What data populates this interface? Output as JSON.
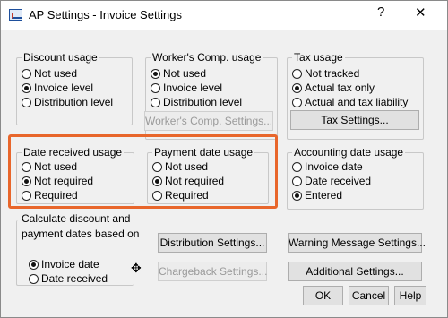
{
  "window": {
    "title": "AP Settings - Invoice Settings",
    "help_glyph": "?",
    "close_glyph": "✕"
  },
  "discount": {
    "legend": "Discount usage",
    "options": [
      "Not used",
      "Invoice level",
      "Distribution level"
    ],
    "selected": 1
  },
  "workers_comp": {
    "legend": "Worker's Comp. usage",
    "options": [
      "Not used",
      "Invoice level",
      "Distribution level"
    ],
    "selected": 0,
    "button": "Worker's Comp. Settings..."
  },
  "tax": {
    "legend": "Tax usage",
    "options": [
      "Not tracked",
      "Actual tax only",
      "Actual and tax liability"
    ],
    "selected": 1,
    "button": "Tax Settings..."
  },
  "date_received": {
    "legend": "Date received usage",
    "options": [
      "Not used",
      "Not required",
      "Required"
    ],
    "selected": 1
  },
  "payment_date": {
    "legend": "Payment date usage",
    "options": [
      "Not used",
      "Not required",
      "Required"
    ],
    "selected": 1
  },
  "accounting_date": {
    "legend": "Accounting date usage",
    "options": [
      "Invoice date",
      "Date received",
      "Entered"
    ],
    "selected": 2
  },
  "calculate": {
    "label_line1": "Calculate discount and",
    "label_line2": "payment dates based on",
    "options": [
      "Invoice date",
      "Date received"
    ],
    "selected": 0
  },
  "buttons": {
    "distribution": "Distribution Settings...",
    "chargeback": "Chargeback Settings...",
    "warning": "Warning Message Settings...",
    "additional": "Additional Settings...",
    "ok": "OK",
    "cancel": "Cancel",
    "help": "Help"
  },
  "highlight_color": "#e8662b"
}
